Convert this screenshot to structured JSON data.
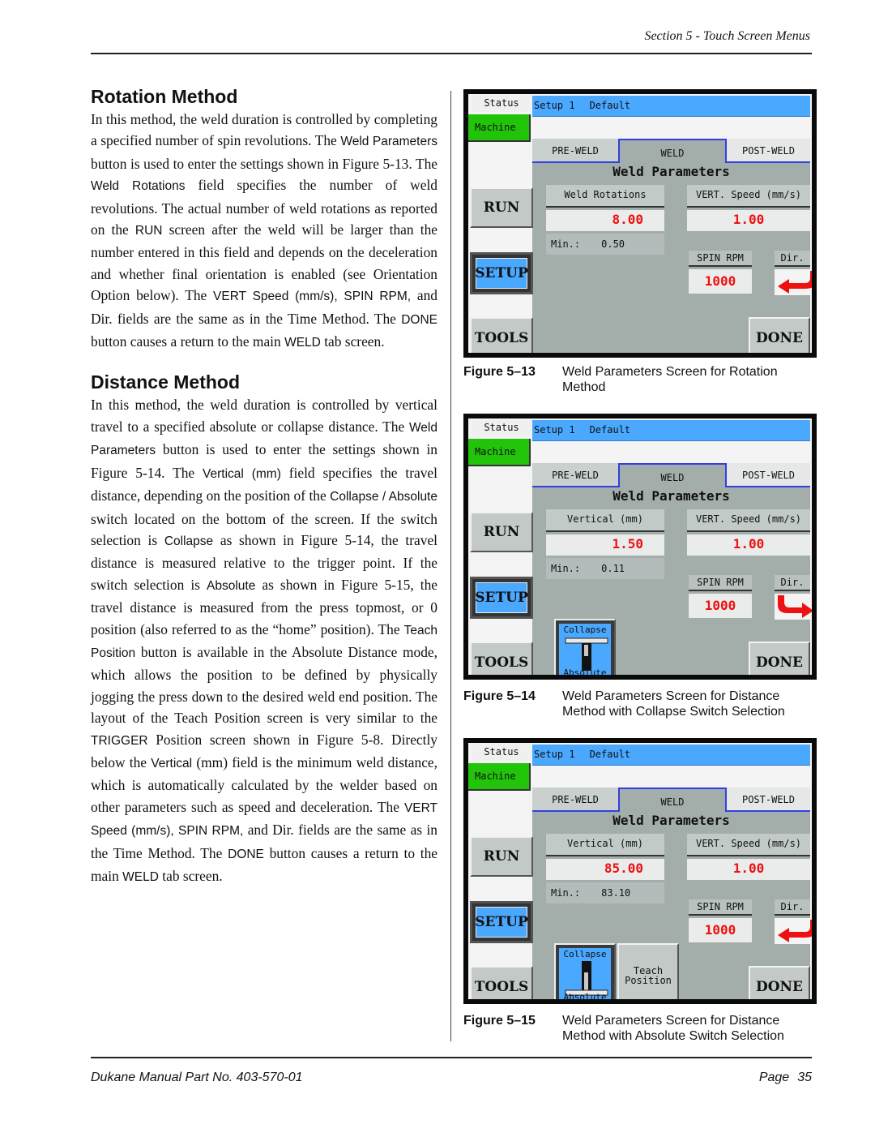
{
  "header": {
    "section": "Section 5 - Touch Screen Menus"
  },
  "left_column": {
    "rotation": {
      "title": "Rotation Method",
      "paragraph": [
        {
          "t": "In this method, the weld duration is controlled by completing a specified number of spin revolutions. The "
        },
        {
          "s": "Weld Parameters"
        },
        {
          "t": " button is used to enter the settings shown in Figure 5-13. The "
        },
        {
          "s": "Weld Rotations"
        },
        {
          "t": " field specifies the number of weld revolutions. The actual number of weld rotations as reported on the "
        },
        {
          "s": "RUN"
        },
        {
          "t": " screen after the weld will be larger than the number entered in this field and depends on the deceleration and whether final orientation is enabled (see Orientation Option below). The "
        },
        {
          "s": "VERT Speed (mm/s), SPIN RPM,"
        },
        {
          "t": " and Dir. fields are the same as in the Time Method. The "
        },
        {
          "s": "DONE"
        },
        {
          "t": " button causes a return to the main "
        },
        {
          "s": "WELD"
        },
        {
          "t": " tab screen."
        }
      ]
    },
    "distance": {
      "title": "Distance Method",
      "paragraph": [
        {
          "t": "In this method, the weld duration is controlled by vertical travel to a specified absolute or collapse distance. The "
        },
        {
          "s": "Weld Parameters"
        },
        {
          "t": " button is used to enter the settings shown in Figure 5-14. The "
        },
        {
          "s": "Vertical (mm)"
        },
        {
          "t": " field specifies the travel distance, depending on the position of the "
        },
        {
          "s": "Collapse / Absolute"
        },
        {
          "t": " switch located on the bottom of the screen. If the switch selection is "
        },
        {
          "s": "Collapse"
        },
        {
          "t": " as shown in Figure 5-14, the travel distance is measured relative to the trigger point. If the switch selection is "
        },
        {
          "s": "Absolute"
        },
        {
          "t": " as shown in Figure 5-15, the travel distance is measured from the press topmost, or 0 position (also referred to as the “home” position). The "
        },
        {
          "s": "Teach Position"
        },
        {
          "t": " button is available in the Absolute Distance mode, which allows the position to be defined by physically jogging the press down to the desired weld end position. The layout of the Teach Position screen is very similar to the "
        },
        {
          "s": "TRIGGER"
        },
        {
          "t": " Position screen shown in Figure 5-8. Directly below the "
        },
        {
          "s": "Vertical"
        },
        {
          "t": " (mm) field is the minimum weld distance, which is automatically calculated by the welder based on other parameters such as speed and deceleration. The "
        },
        {
          "s": "VERT Speed (mm/s), SPIN RPM,"
        },
        {
          "t": " and Dir. fields are the same as in the Time Method.  The "
        },
        {
          "s": "DONE"
        },
        {
          "t": " button causes a return to the main "
        },
        {
          "s": "WELD"
        },
        {
          "t": " tab screen."
        }
      ]
    }
  },
  "screens": [
    {
      "status": "Status",
      "machine": "Machine",
      "setup_name": "Setup 1",
      "setup_profile": "Default",
      "tabs": [
        "PRE-WELD",
        "WELD",
        "POST-WELD"
      ],
      "active_tab": "WELD",
      "panel_title": "Weld Parameters",
      "primary_field": {
        "label": "Weld Rotations",
        "value": "8.00",
        "min_label": "Min.:",
        "min_value": "0.50"
      },
      "speed_field": {
        "label": "VERT. Speed (mm/s)",
        "value": "1.00"
      },
      "rpm_field": {
        "label": "SPIN RPM",
        "value": "1000"
      },
      "dir_field": {
        "label": "Dir.",
        "icon": "arrow-ccw-icon"
      },
      "buttons": {
        "run": "RUN",
        "setup": "SETUP",
        "tools": "TOOLS",
        "done": "DONE"
      },
      "switch": null,
      "teach": null,
      "caption": {
        "number": "Figure 5–13",
        "text": "Weld Parameters Screen for Rotation Method"
      }
    },
    {
      "status": "Status",
      "machine": "Machine",
      "setup_name": "Setup 1",
      "setup_profile": "Default",
      "tabs": [
        "PRE-WELD",
        "WELD",
        "POST-WELD"
      ],
      "active_tab": "WELD",
      "panel_title": "Weld Parameters",
      "primary_field": {
        "label": "Vertical (mm)",
        "value": "1.50",
        "min_label": "Min.:",
        "min_value": "0.11"
      },
      "speed_field": {
        "label": "VERT. Speed (mm/s)",
        "value": "1.00"
      },
      "rpm_field": {
        "label": "SPIN RPM",
        "value": "1000"
      },
      "dir_field": {
        "label": "Dir.",
        "icon": "arrow-cw-icon"
      },
      "buttons": {
        "run": "RUN",
        "setup": "SETUP",
        "tools": "TOOLS",
        "done": "DONE"
      },
      "switch": {
        "top": "Collapse",
        "bottom": "Absolute",
        "selected": "Collapse"
      },
      "teach": null,
      "caption": {
        "number": "Figure 5–14",
        "text": "Weld Parameters Screen for Distance Method with Collapse Switch Selection"
      }
    },
    {
      "status": "Status",
      "machine": "Machine",
      "setup_name": "Setup 1",
      "setup_profile": "Default",
      "tabs": [
        "PRE-WELD",
        "WELD",
        "POST-WELD"
      ],
      "active_tab": "WELD",
      "panel_title": "Weld Parameters",
      "primary_field": {
        "label": "Vertical (mm)",
        "value": "85.00",
        "min_label": "Min.:",
        "min_value": "83.10"
      },
      "speed_field": {
        "label": "VERT. Speed (mm/s)",
        "value": "1.00"
      },
      "rpm_field": {
        "label": "SPIN RPM",
        "value": "1000"
      },
      "dir_field": {
        "label": "Dir.",
        "icon": "arrow-ccw-icon"
      },
      "buttons": {
        "run": "RUN",
        "setup": "SETUP",
        "tools": "TOOLS",
        "done": "DONE"
      },
      "switch": {
        "top": "Collapse",
        "bottom": "Absolute",
        "selected": "Absolute"
      },
      "teach": {
        "line1": "Teach",
        "line2": "Position"
      },
      "caption": {
        "number": "Figure 5–15",
        "text": "Weld Parameters Screen for Distance Method with Absolute Switch Selection"
      }
    }
  ],
  "colors": {
    "status_green": "#22c40a",
    "setup_blue": "#4aa8ff",
    "value_red": "#ee1111",
    "panel_gray": "#a3adaa",
    "tab_border_blue": "#3040e0"
  },
  "footer": {
    "manual": "Dukane Manual Part No. 403-570-01",
    "page_label": "Page",
    "page_number": "35"
  }
}
